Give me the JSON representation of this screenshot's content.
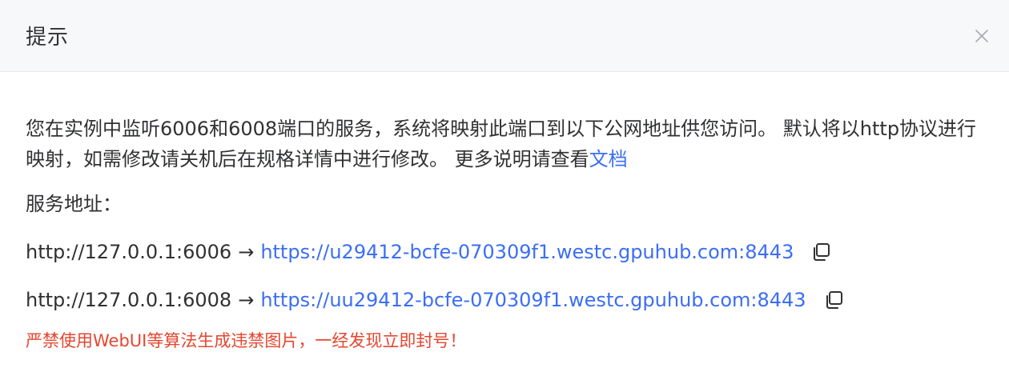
{
  "dialog": {
    "title": "提示",
    "close_icon": "close-icon"
  },
  "content": {
    "description": "您在实例中监听6006和6008端口的服务，系统将映射此端口到以下公网地址供您访问。 默认将以http协议进行映射，如需修改请关机后在规格详情中进行修改。 更多说明请查看",
    "doc_link": "文档",
    "service_label": "服务地址：",
    "mappings": [
      {
        "local": "http://127.0.0.1:6006",
        "arrow": "→",
        "public": "https://u29412-bcfe-070309f1.westc.gpuhub.com:8443",
        "copy_icon": "copy-icon"
      },
      {
        "local": "http://127.0.0.1:6008",
        "arrow": "→",
        "public": "https://uu29412-bcfe-070309f1.westc.gpuhub.com:8443",
        "copy_icon": "copy-icon"
      }
    ],
    "warning": "严禁使用WebUI等算法生成违禁图片，一经发现立即封号！"
  },
  "colors": {
    "link": "#3b6ef5",
    "warning": "#e5462f",
    "header_bg": "#f7f8fa",
    "text": "#303133"
  }
}
